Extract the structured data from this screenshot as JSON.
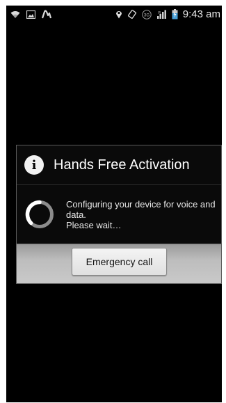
{
  "status_bar": {
    "time": "9:43 am",
    "network_badge": "3G",
    "left_icons": [
      "wifi-icon",
      "image-icon",
      "activity-icon"
    ],
    "right_icons": [
      "location-icon",
      "rotate-icon",
      "3g-icon",
      "signal-icon",
      "battery-icon"
    ]
  },
  "dialog": {
    "icon": "info-icon",
    "title": "Hands Free Activation",
    "message_line1": "Configuring your device for voice and data.",
    "message_line2": "Please wait…",
    "emergency_button_label": "Emergency call"
  },
  "colors": {
    "background": "#000000",
    "dialog_border": "#5a5a5a",
    "footer": "#bdbdbd",
    "spinner_ring": "#8c8c8c",
    "spinner_arc": "#ffffff"
  }
}
